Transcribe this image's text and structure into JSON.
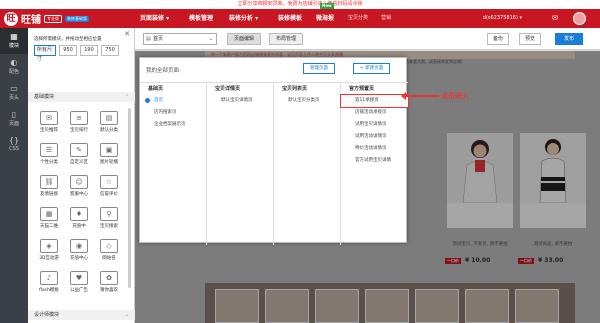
{
  "notice": "立即分享御报到员新，免费为店铺引流 | 微信扫码请点我",
  "topnav": {
    "logo_text": "旺铺",
    "badge": "专业版",
    "badge2": "装修基础版",
    "items": [
      "页面装修 ▾",
      "模板管理",
      "装修分析 ▾",
      "装修模板",
      "微海报",
      "宝贝分类",
      "营销"
    ],
    "new_tag": "New",
    "account": "d(s62375816) ▾"
  },
  "rail": [
    {
      "label": "模块",
      "icon": "grid-icon"
    },
    {
      "label": "配色",
      "icon": "palette-icon"
    },
    {
      "label": "页头",
      "icon": "header-icon"
    },
    {
      "label": "页面",
      "icon": "page-icon"
    },
    {
      "label": "CSS",
      "icon": "code-icon"
    }
  ],
  "panel": {
    "tip": "选择所需模块，并拖动至相应位置",
    "size_select": "所有尺寸",
    "sizes": [
      "950",
      "190",
      "750"
    ],
    "basic_heading": "基础模块",
    "design_heading": "设计师模块",
    "modules": [
      {
        "label": "宝贝推荐",
        "glyph": "✉"
      },
      {
        "label": "宝贝排行",
        "glyph": "≡"
      },
      {
        "label": "默认分类",
        "glyph": "▤"
      },
      {
        "label": "个性分类",
        "glyph": "☰"
      },
      {
        "label": "自定义区",
        "glyph": "✎"
      },
      {
        "label": "图片轮播",
        "glyph": "▣"
      },
      {
        "label": "友情链接",
        "glyph": "⛓"
      },
      {
        "label": "客服中心",
        "glyph": "☺"
      },
      {
        "label": "信誉评价",
        "glyph": "☆"
      },
      {
        "label": "天猫二维",
        "glyph": "▦"
      },
      {
        "label": "充值中",
        "glyph": "♦"
      },
      {
        "label": "宝贝搜索",
        "glyph": "⚲"
      },
      {
        "label": "3D互动游",
        "glyph": "◈"
      },
      {
        "label": "充值中心",
        "glyph": "◉"
      },
      {
        "label": "网站名",
        "glyph": "◇"
      },
      {
        "label": "flash模板",
        "glyph": "♪"
      },
      {
        "label": "公益广告",
        "glyph": "♥"
      },
      {
        "label": "猜你喜欢",
        "glyph": "✿"
      }
    ]
  },
  "toolbar": {
    "page_select": "首页",
    "tabs": [
      "页面编辑",
      "布局管理"
    ],
    "backup": "备份",
    "preview": "预览",
    "publish": "发布"
  },
  "canvas": {
    "strip_text": "每一个新客户都为您的店铺带来意外惊喜：宝贝页面上传人物主页头条直播",
    "strip2_text": "（点击查看大图，或直接转发到店铺）",
    "products": [
      {
        "desc": "测试宝贝, 不发货, 请不要拍",
        "buy": "一口价",
        "price": "¥ 10.00"
      },
      {
        "desc": "测试商品, 请不要拍",
        "buy": "一口价",
        "price": "¥ 33.00"
      }
    ]
  },
  "popup": {
    "title": "我的全部页面:",
    "manage_btn": "管理页面",
    "new_btn": "+ 新建页面",
    "columns": [
      {
        "head": "基础页",
        "items": [
          "首页",
          "店内搜索页",
          "企业档案展示页"
        ]
      },
      {
        "head": "宝贝详情页",
        "items": [
          "默认宝贝详情页"
        ]
      },
      {
        "head": "宝贝列表页",
        "items": [
          "默认宝贝分类页"
        ]
      },
      {
        "head": "官方预置页",
        "items": [
          "双11承接页",
          "店铺活动承接页",
          "试用宝贝详情页",
          "试用活动详情页",
          "特价活动详情页",
          "官方试用宝贝详情"
        ]
      }
    ]
  },
  "annotation": "点击进入"
}
